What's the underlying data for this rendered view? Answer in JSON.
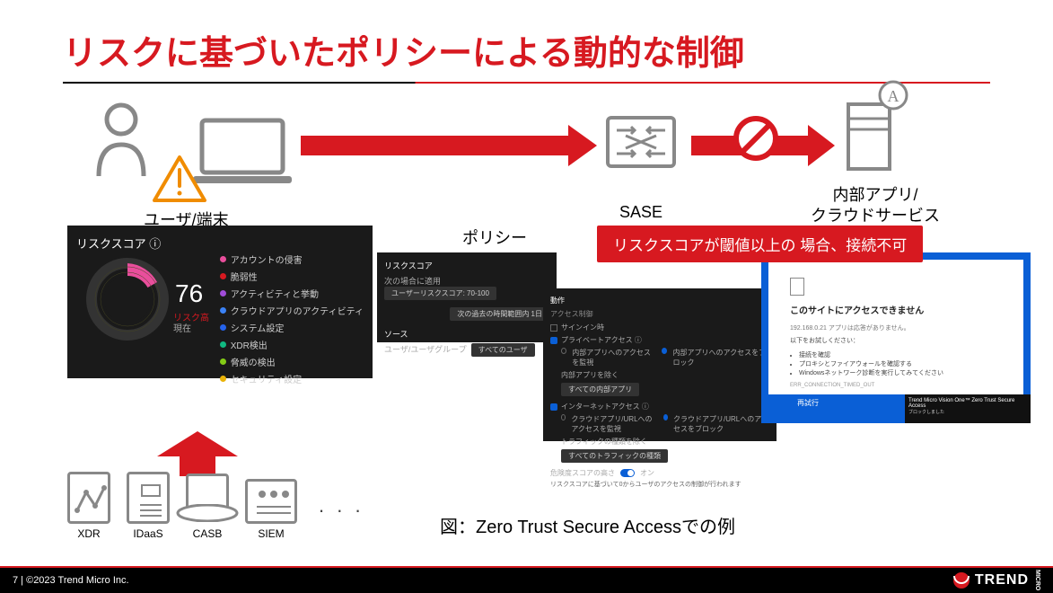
{
  "title": "リスクに基づいたポリシーによる動的な制御",
  "labels": {
    "user": "ユーザ/端末",
    "sase": "SASE",
    "app": "内部アプリ/\nクラウドサービス",
    "policy": "ポリシー",
    "risk_title": "リスクスコア ⓘ",
    "risk_score": "76",
    "risk_sub": "リスク高",
    "risk_sub2": "現在"
  },
  "legend": [
    {
      "color": "#e94e9c",
      "text": "アカウントの侵害"
    },
    {
      "color": "#d71920",
      "text": "脆弱性"
    },
    {
      "color": "#a04cd8",
      "text": "アクティビティと挙動"
    },
    {
      "color": "#3b82f6",
      "text": "クラウドアプリのアクティビティ"
    },
    {
      "color": "#2563eb",
      "text": "システム設定"
    },
    {
      "color": "#10b981",
      "text": "XDR検出"
    },
    {
      "color": "#84cc16",
      "text": "脅威の検出"
    },
    {
      "color": "#eab308",
      "text": "セキュリティ設定"
    }
  ],
  "policy1": {
    "h1": "リスクスコア",
    "r1a": "次の場合に適用",
    "r1b": "ユーザーリスクスコア: 70-100",
    "r1c": "次の過去の時間範囲内 1日",
    "h2": "ソース",
    "r2a": "ユーザ/ユーザグループ",
    "r2b": "すべてのユーザ"
  },
  "policy2": {
    "h": "動作",
    "a": "アクセス制御",
    "c1": "サインイン時",
    "c2": "プライベートアクセス ⓘ",
    "r2a": "内部アプリへのアクセスを監視",
    "r2b": "内部アプリへのアクセスをブロック",
    "l3": "内部アプリを除く",
    "s3": "すべての内部アプリ",
    "c4": "インターネットアクセス ⓘ",
    "r4a": "クラウドアプリ/URLへのアクセスを監視",
    "r4b": "クラウドアプリ/URLへのアクセスをブロック",
    "l5": "トラフィックの種類を除く",
    "s5": "すべてのトラフィックの種類",
    "l6": "危険度スコアの高さ",
    "t6": "オン",
    "l7": "リスクスコアに基づいて0からユーザのアクセスの制御が行われます"
  },
  "callout": "リスクスコアが閾値以上の 場合、接続不可",
  "blocked": {
    "icon_alt": "page",
    "h": "このサイトにアクセスできません",
    "sub": "192.168.0.21 アプリは応答がありません。",
    "try": "以下をお試しください：",
    "items": [
      "接続を確認",
      "プロキシとファイアウォールを確認する",
      "Windowsネットワーク診断を実行してみてください"
    ],
    "code": "ERR_CONNECTION_TIMED_OUT",
    "toast_t": "Trend Micro Vision One™ Zero Trust Secure Access",
    "toast_b": "ブロックしました"
  },
  "bottom": {
    "xdr": "XDR",
    "idaas": "IDaaS",
    "casb": "CASB",
    "siem": "SIEM"
  },
  "caption": "図：Zero Trust Secure Accessでの例",
  "footer": {
    "left": "7 | ©2023 Trend Micro Inc.",
    "brand": "TREND",
    "brand_sub": "MICRO"
  }
}
